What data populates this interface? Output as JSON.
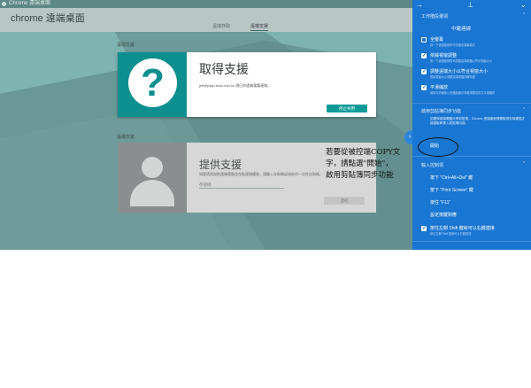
{
  "window": {
    "title": "Chrome 遠端桌面"
  },
  "header": {
    "app_title": "chrome 遠端桌面",
    "tabs": [
      {
        "label": "遠端存取"
      },
      {
        "label": "遠端支援"
      }
    ]
  },
  "sections": {
    "remote_support_label": "遠端支援",
    "remote_access_label": "遠端支援"
  },
  "card_get": {
    "title": "取得支援",
    "description": "jeff@jhjsp.kimu.edu.tw 現已與遠端電腦連線。",
    "button": "停止共用"
  },
  "card_give": {
    "title": "提供支援",
    "description": "如要透過協助遠端電腦並存取連線權限，請輸入存取碼或協助的一次性存取碼。",
    "input_placeholder": "存取碼",
    "button": "連結"
  },
  "annotation": {
    "lines": [
      "若要從被控端COPY文",
      "字，請點選\"開始\"，",
      "啟用剪貼簿同步功能"
    ]
  },
  "panel": {
    "section_session": "工作階段選項",
    "item_fullscreen": "全螢幕",
    "item_fullscreen_sub": "按一下這個按鈕即可切換全螢幕模式",
    "item_fit": "依據視窗調整",
    "item_fit_sub": "按一下這個按鈕即可調整遠端電腦以符合視窗大小",
    "item_resize": "調整遠端大小以符合視窗大小",
    "item_resize_sub": "根據視窗大小調整遠端電腦的解析度",
    "item_smooth": "平滑縮放",
    "item_smooth_sub": "使用平滑縮放以在縮放顯示時獲得更佳的文字與圖形",
    "section_clipboard": "啟用剪貼簿同步功能",
    "clipboard_desc": "如要與遠端電腦分享剪貼簿，Chrome 遠端桌面需要取得存取權限才能讀取和寫入剪貼簿內容。",
    "clipboard_action": "開始",
    "section_input": "輸入控制項",
    "input_1": "按下 \"Ctrl+Alt+Del\" 鍵",
    "input_2": "按下 \"Print Screen\" 鍵",
    "input_3": "按住 \"F11\"",
    "input_4": "設定按鍵對應",
    "item_rightclick": "按住左側 Shift 鍵就可以右鍵連接",
    "item_rightclick_sub": "按住左側 Shift 鍵就可以右鍵點按",
    "checks": {
      "fullscreen": false,
      "fit": true,
      "resize": true,
      "smooth": true,
      "rightclick": true
    }
  },
  "colors": {
    "panel": "#1976d2",
    "accent": "#0d8f90"
  }
}
